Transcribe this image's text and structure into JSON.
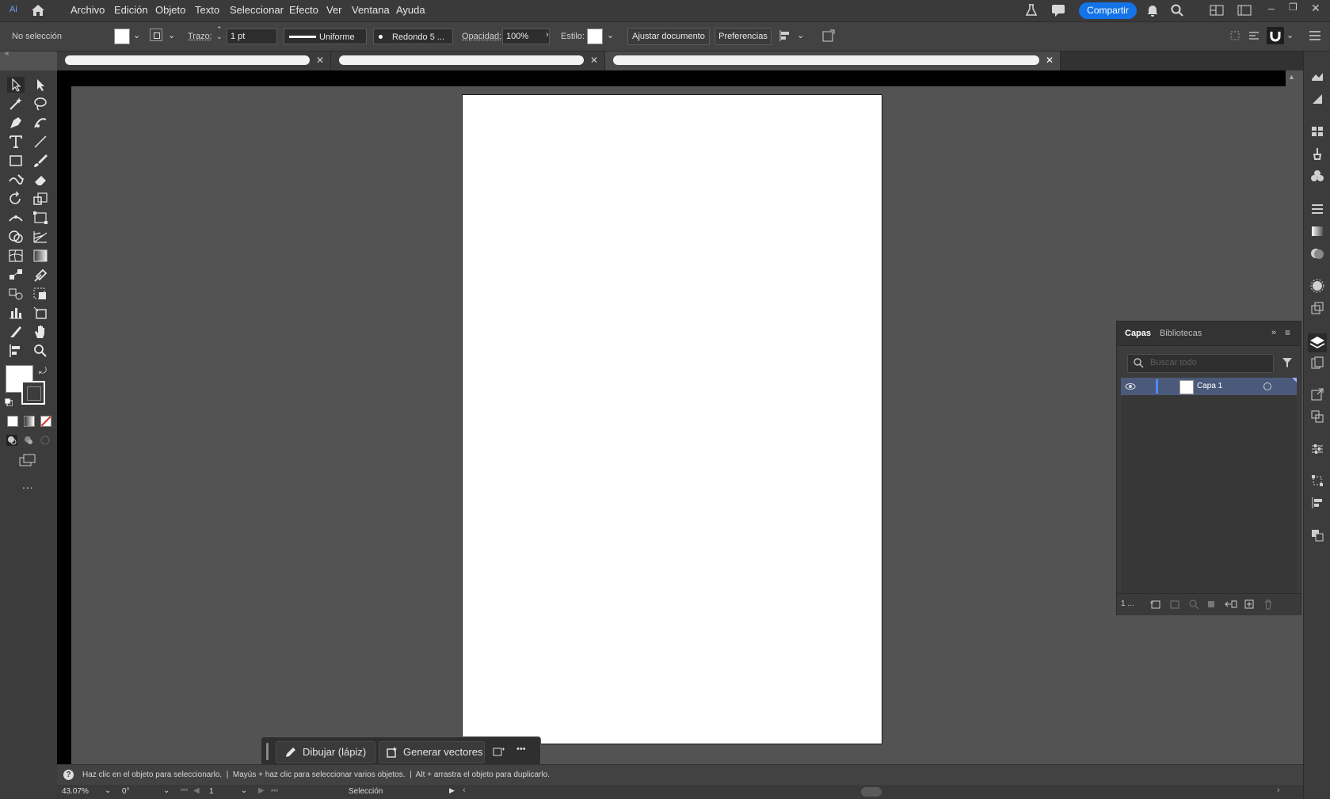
{
  "menu": {
    "app_badge": "Ai",
    "items": [
      "Archivo",
      "Edición",
      "Objeto",
      "Texto",
      "Seleccionar",
      "Efecto",
      "Ver",
      "Ventana",
      "Ayuda"
    ],
    "share_label": "Compartir"
  },
  "control": {
    "selection_status": "No selección",
    "stroke_label": "Trazo:",
    "stroke_weight": "1 pt",
    "profile_label": "Uniforme",
    "brush_label": "Redondo 5 ...",
    "opacity_label": "Opacidad:",
    "opacity_value": "100%",
    "style_label": "Estilo:",
    "fit_document_label": "Ajustar documento",
    "preferences_label": "Preferencias"
  },
  "tabs": [
    {
      "title": "",
      "active": false
    },
    {
      "title": "",
      "active": false
    },
    {
      "title": "",
      "active": true
    }
  ],
  "layers_panel": {
    "tab_layers": "Capas",
    "tab_libraries": "Bibliotecas",
    "search_placeholder": "Buscar todo",
    "layers": [
      {
        "name": "Capa 1",
        "visible": true
      }
    ],
    "layer_count": "1 ..."
  },
  "context_bar": {
    "draw_label": "Dibujar (lápiz)",
    "vectorize_label": "Generar vectores",
    "more_label": "•••"
  },
  "hint": "Haz clic en el objeto para seleccionarlo.  |  Mayús + haz clic para seleccionar varios objetos.  |  Alt + arrastra el objeto para duplicarlo.",
  "status": {
    "zoom": "43.07%",
    "rotation": "0°",
    "artboard_number": "1",
    "tool_name": "Selección"
  },
  "toolbar": {
    "more_label": "..."
  },
  "colors": {
    "accent": "#1473e6",
    "artboard": "#ffffff",
    "workspace": "#535353"
  }
}
